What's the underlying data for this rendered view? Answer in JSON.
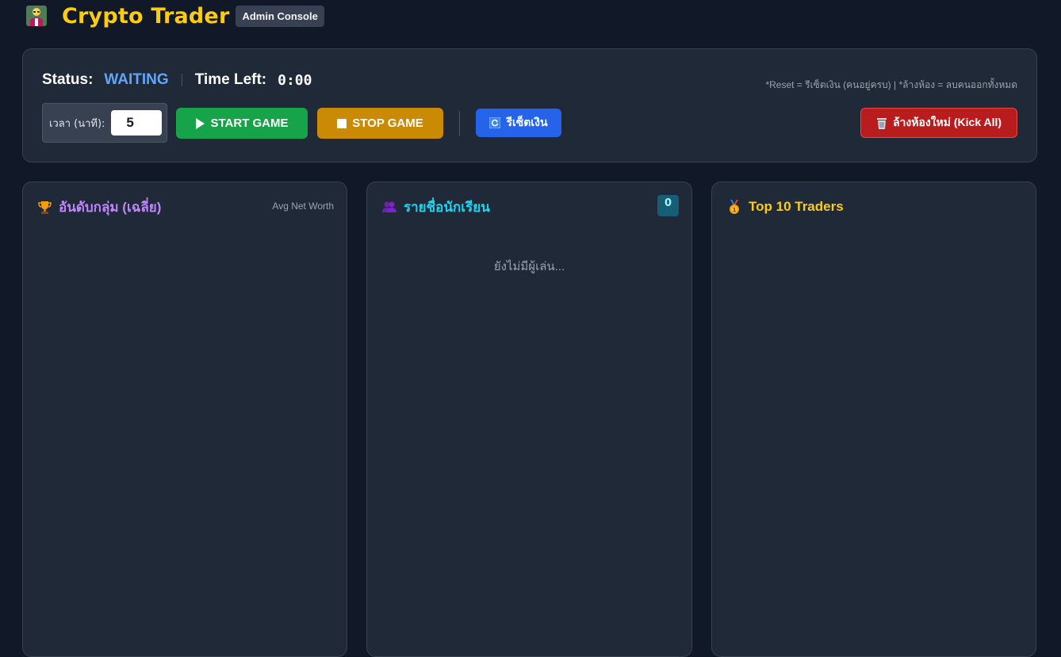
{
  "header": {
    "title": "Crypto Trader",
    "badge": "Admin Console",
    "logo_icon": "teacher-icon"
  },
  "controls": {
    "status_label": "Status:",
    "status_value": "WAITING",
    "time_label": "Time Left:",
    "time_value": "0:00",
    "hint": "*Reset = รีเซ็ตเงิน (คนอยู่ครบ) | *ล้างห้อง = ลบคนออกทั้งหมด",
    "duration_label": "เวลา (นาที):",
    "duration_value": "5",
    "start_label": "START GAME",
    "stop_label": "STOP GAME",
    "reset_label": "รีเซ็ตเงิน",
    "kick_label": "ล้างห้องใหม่ (Kick All)"
  },
  "panels": {
    "groups": {
      "title": "อันดับกลุ่ม (เฉลี่ย)",
      "subtitle": "Avg Net Worth",
      "icon": "trophy-icon"
    },
    "students": {
      "title": "รายชื่อนักเรียน",
      "count": "0",
      "empty": "ยังไม่มีผู้เล่น...",
      "icon": "users-icon"
    },
    "top": {
      "title": "Top 10 Traders",
      "icon": "medal-icon"
    }
  },
  "colors": {
    "background": "#111827",
    "panel": "#1f2937",
    "accent_yellow": "#facc15",
    "status_blue": "#60a5fa",
    "start_green": "#16a34a",
    "stop_amber": "#ca8a04",
    "reset_blue": "#2563eb",
    "kick_red": "#b91c1c"
  }
}
